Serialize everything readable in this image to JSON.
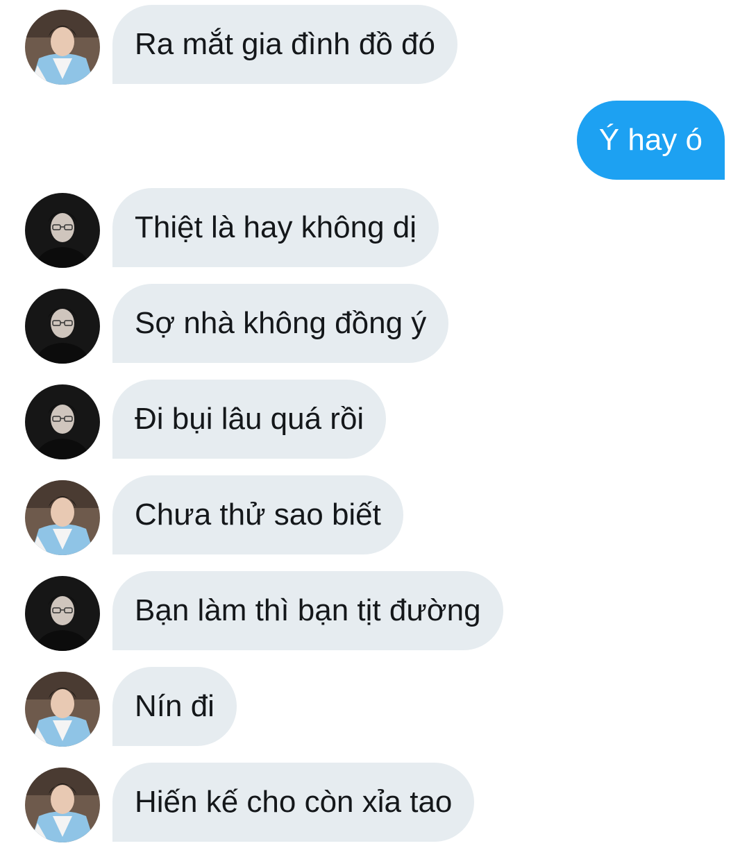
{
  "conversation": {
    "messages": [
      {
        "direction": "in",
        "avatar": "hanbok-avatar",
        "text": "Ra mắt gia đình đồ đó"
      },
      {
        "direction": "out",
        "avatar": "",
        "text": "Ý hay ó"
      },
      {
        "direction": "in",
        "avatar": "glasses-avatar",
        "text": "Thiệt là hay không dị"
      },
      {
        "direction": "in",
        "avatar": "glasses-avatar",
        "text": "Sợ nhà không đồng ý"
      },
      {
        "direction": "in",
        "avatar": "glasses-avatar",
        "text": "Đi bụi lâu quá rồi"
      },
      {
        "direction": "in",
        "avatar": "hanbok-avatar",
        "text": "Chưa thử sao biết"
      },
      {
        "direction": "in",
        "avatar": "glasses-avatar",
        "text": "Bạn làm thì bạn tịt đường"
      },
      {
        "direction": "in",
        "avatar": "hanbok-avatar",
        "text": "Nín đi"
      },
      {
        "direction": "in",
        "avatar": "hanbok-avatar",
        "text": "Hiến kế cho còn xỉa tao"
      }
    ]
  },
  "colors": {
    "incoming_bubble": "#e6ecf0",
    "outgoing_bubble": "#1da1f2",
    "incoming_text": "#14171a",
    "outgoing_text": "#ffffff"
  }
}
